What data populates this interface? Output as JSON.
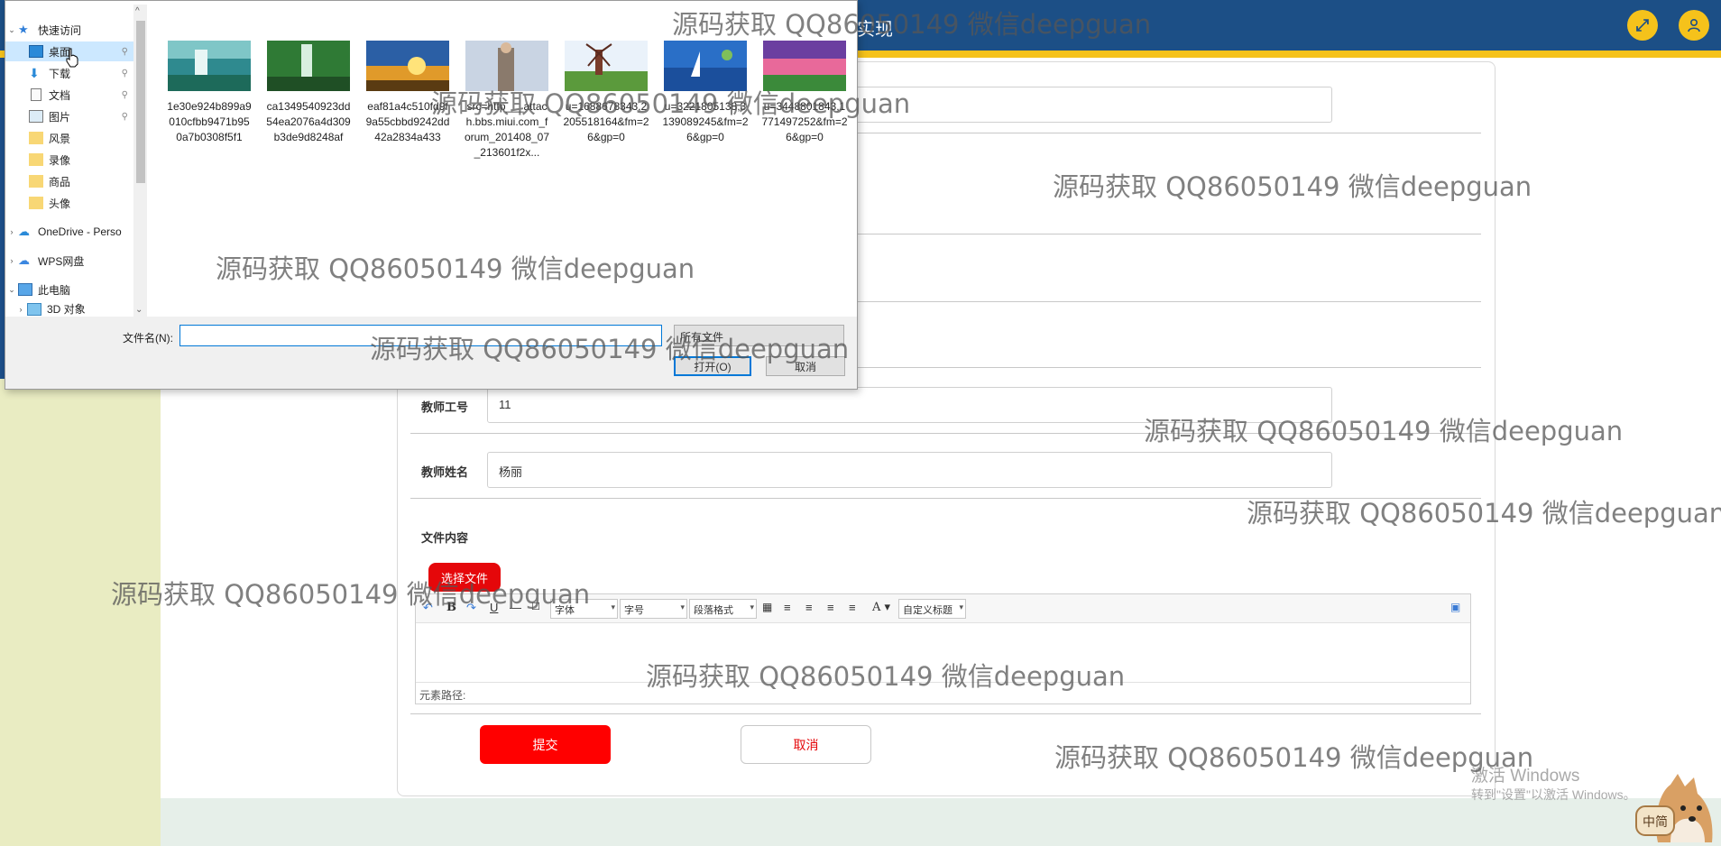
{
  "app": {
    "title_fragment": "实现",
    "fullscreen_icon": "expand-icon",
    "user_icon": "user-icon"
  },
  "form": {
    "teacher_id_label": "教师工号",
    "teacher_id_value": "11",
    "teacher_name_label": "教师姓名",
    "teacher_name_value": "杨丽",
    "file_content_label": "文件内容",
    "pick_file_button": "选择文件",
    "editor": {
      "font_family": "字体",
      "font_size": "字号",
      "paragraph": "段落格式",
      "custom_title": "自定义标题",
      "element_path_label": "元素路径:"
    },
    "submit_button": "提交",
    "cancel_button": "取消"
  },
  "dialog": {
    "nav": {
      "quick_access": "快速访问",
      "items": [
        "桌面",
        "下载",
        "文档",
        "图片",
        "风景",
        "录像",
        "商品",
        "头像"
      ],
      "onedrive": "OneDrive - Perso",
      "wps": "WPS网盘",
      "this_pc": "此电脑",
      "objects_3d": "3D 对象"
    },
    "files": [
      {
        "name": "1e30e924b899a9010cfbb9471b950a7b0308f5f1"
      },
      {
        "name": "ca1349540923dd54ea2076a4d309b3de9d8248af"
      },
      {
        "name": "eaf81a4c510fd9f9a55cbbd9242dd42a2834a433"
      },
      {
        "name": "src=http___attach.bbs.miui.com_forum_201408_07_213601f2x..."
      },
      {
        "name": "u=1688678343,2205518164&fm=26&gp=0"
      },
      {
        "name": "u=3221805138,3139089245&fm=26&gp=0"
      },
      {
        "name": "u=3448801843,1771497252&fm=26&gp=0"
      }
    ],
    "filename_label": "文件名(N):",
    "filetype_value": "所有文件",
    "open_button": "打开(O)",
    "cancel_button": "取消"
  },
  "windows_activation": {
    "line1": "激活 Windows",
    "line2": "转到\"设置\"以激活 Windows。"
  },
  "mascot_text": "中简",
  "watermark_text": "源码获取 QQ86050149 微信deepguan",
  "colors": {
    "topbar": "#1c4f86",
    "accent_yellow": "#f5c21b",
    "submit_red": "#ff0000",
    "dialog_select": "#cce8ff"
  }
}
